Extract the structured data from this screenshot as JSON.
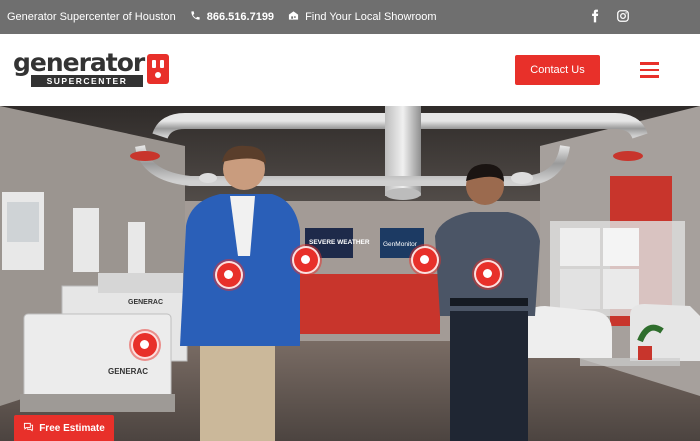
{
  "topbar": {
    "company": "Generator Supercenter of Houston",
    "phone": "866.516.7199",
    "showroom": "Find Your Local Showroom",
    "icons": [
      "phone-icon",
      "store-icon",
      "facebook-icon",
      "instagram-icon"
    ]
  },
  "header": {
    "logo_word": "generator",
    "logo_sub": "SUPERCENTER",
    "contact_label": "Contact Us"
  },
  "hero": {
    "screen_left": "SEVERE WEATHER",
    "screen_right": "GenMonitor",
    "generac_1": "GENERAC",
    "generac_2": "GENERAC"
  },
  "cta": {
    "estimate_label": "Free Estimate"
  },
  "colors": {
    "accent": "#e8302a",
    "topbar": "#6f6f6f",
    "dark": "#333333"
  }
}
